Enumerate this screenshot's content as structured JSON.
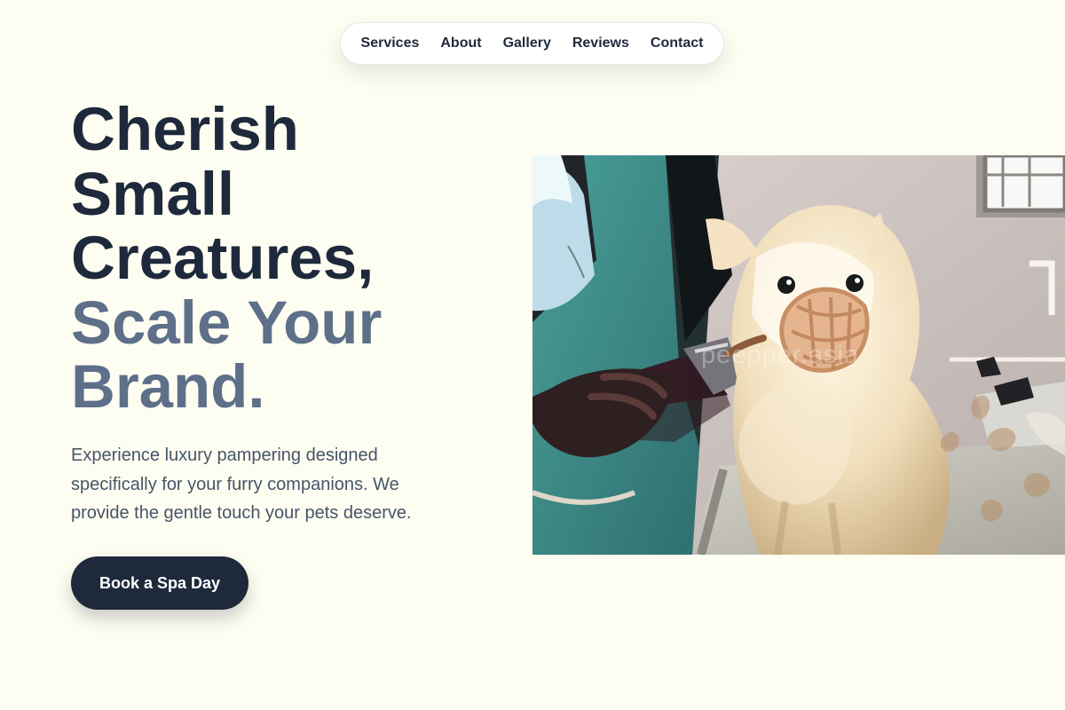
{
  "nav": {
    "items": [
      "Services",
      "About",
      "Gallery",
      "Reviews",
      "Contact"
    ]
  },
  "hero": {
    "headline_dark": [
      "Cherish",
      "Small",
      "Creatures,"
    ],
    "headline_muted": [
      "Scale Your",
      "Brand."
    ],
    "description": "Experience luxury pampering designed specifically for your furry companions. We provide the gentle touch your pets deserve.",
    "cta_label": "Book a Spa Day"
  },
  "image": {
    "alt": "Groomer using clippers on a muzzled cream Pomeranian on a grooming table",
    "watermark": "peepper.asia"
  },
  "colors": {
    "page_bg": "#fefdf1",
    "dark": "#1e293b",
    "muted": "#5e6f89",
    "body_text": "#475569",
    "nav_bg": "#ffffff",
    "cta_bg": "#1e293b"
  }
}
